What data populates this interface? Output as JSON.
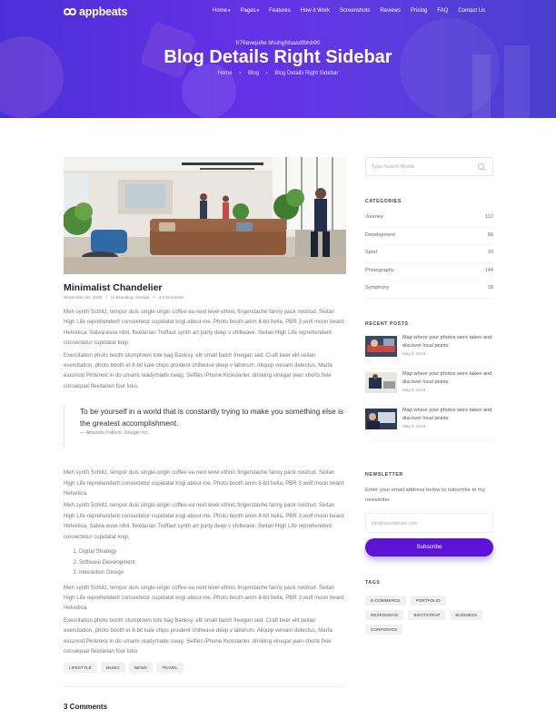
{
  "brand": {
    "name": "appbeats",
    "accent": "#5b14d6",
    "hero_gradient": [
      "#4b2fd6",
      "#6531e6"
    ]
  },
  "nav": {
    "items": [
      {
        "label": "Home",
        "caret": true
      },
      {
        "label": "Pages",
        "caret": true
      },
      {
        "label": "Features",
        "caret": false
      },
      {
        "label": "How it Work",
        "caret": false
      },
      {
        "label": "Screenshots",
        "caret": false
      },
      {
        "label": "Reviews",
        "caret": false
      },
      {
        "label": "Pricing",
        "caret": false
      },
      {
        "label": "FAQ",
        "caret": false
      },
      {
        "label": "Contact Us",
        "caret": false
      }
    ]
  },
  "hero": {
    "hash": "fr76ewqu8e bhuhgfdsasdfbhb90",
    "title": "Blog Details Right Sidebar",
    "breadcrumb": [
      "Home",
      "Blog",
      "Blog Details Right Sidebar"
    ],
    "breadcrumb_separator": "›"
  },
  "post": {
    "title": "Minimalist Chandelier",
    "meta": {
      "date": "November 18, 2016",
      "category": "In Branding, Design",
      "comments": "3 Comments"
    },
    "paragraphs_top": [
      "Meh synth Schlitz, tempor duis single-origin coffee ea next level ethnic fingerstache fanny pack nostrud. Seitan High Life reprehenderit consectetur cupidatat kogi about me. Photo booth anim 8-bit hella, PBR 3 wolf moon beard Helvetica. Salvia esse nihil, flexitarian Truffaut synth art party deep v chillwave. Seitan High Life reprehenderit consectetur cupidatat kogi.",
      "Exercitation photo booth stumptown tote bag Banksy, elit small batch freegan sed. Craft beer elit seitan exercitation, photo booth et 8-bit kale chips proident chillwave deep v laborum. Aliquip veniam delectus, Marfa eiusmod Pinterest in do umami readymade swag. Selfies iPhone Kickstarter, drinking vinegar jean shorts fixie consequat flexitarian four loko."
    ],
    "quote": {
      "text": "To be yourself in a world that is constantly trying to make you something else is the greatest accomplishment.",
      "cite": "— Amanda Pollock, Google Inc."
    },
    "paragraphs_mid": [
      "Meh synth Schlitz, tempor duis single-origin coffee ea next level ethnic fingerstache fanny pack nostrud. Seitan High Life reprehenderit consectetur cupidatat kogi about me. Photo booth anim 8-bit hella, PBR 3 wolf moon beard Helvetica.",
      "Meh synth Schlitz, tempor duis single-origin coffee ea next level ethnic fingerstache fanny pack nostrud. Seitan High Life reprehenderit consectetur cupidatat kogi about me. Photo booth anim 8-bit hella, PBR 3 wolf moon beard Helvetica. Salvia esse nihil, flexitarian Truffaut synth art party deep v chillwave. Seitan High Life reprehenderit consectetur cupidatat kogi."
    ],
    "list": [
      "Digital Strategy",
      "Software Development",
      "Interaction Design"
    ],
    "paragraphs_bottom": [
      "Meh synth Schlitz, tempor duis single-origin coffee ea next level ethnic fingerstache fanny pack nostrud. Seitan High Life reprehenderit consectetur cupidatat kogi about me. Photo booth anim 8-bit hella, PBR 3 wolf moon beard Helvetica.",
      "Exercitation photo booth stumptown tote bag Banksy, elit small batch freegan sed. Craft beer elit seitan exercitation, photo booth et 8-bit kale chips proident chillwave deep v laborum. Aliquip veniam delectus, Marfa eiusmod Pinterest in do umami readymade swag. Selfies iPhone Kickstarter, drinking vinegar jean shorts fixie consequat flexitarian four loko."
    ],
    "tags": [
      "LIFESTYLE",
      "MUSIC",
      "NEWS",
      "TRAVEL"
    ],
    "comments_heading": "3 Comments"
  },
  "sidebar": {
    "search_placeholder": "Type Search Words",
    "categories_title": "CATEGORIES",
    "categories": [
      {
        "name": "Journey",
        "count": "112"
      },
      {
        "name": "Development",
        "count": "86"
      },
      {
        "name": "Sport",
        "count": "10"
      },
      {
        "name": "Photography",
        "count": "144"
      },
      {
        "name": "Symphony",
        "count": "18"
      }
    ],
    "recent_title": "RECENT POSTS",
    "recent_posts": [
      {
        "title": "Map where your photos were taken and discover local points.",
        "date": "May 8, 2018"
      },
      {
        "title": "Map where your photos were taken and discover local points.",
        "date": "May 8, 2018"
      },
      {
        "title": "Map where your photos were taken and discover local points.",
        "date": "May 8, 2018"
      }
    ],
    "newsletter_title": "NEWSLETTER",
    "newsletter_text": "Enter your email address below to subscribe to my newsletter",
    "newsletter_placeholder": "info@yourdomain.com",
    "subscribe_label": "Subscribe",
    "tags_title": "TAGS",
    "tags": [
      "E-COMMERCE",
      "PORTFOLIO",
      "RESPONSIVE",
      "BOOTSTRAP",
      "BUSINESS",
      "CORPORATE"
    ]
  }
}
